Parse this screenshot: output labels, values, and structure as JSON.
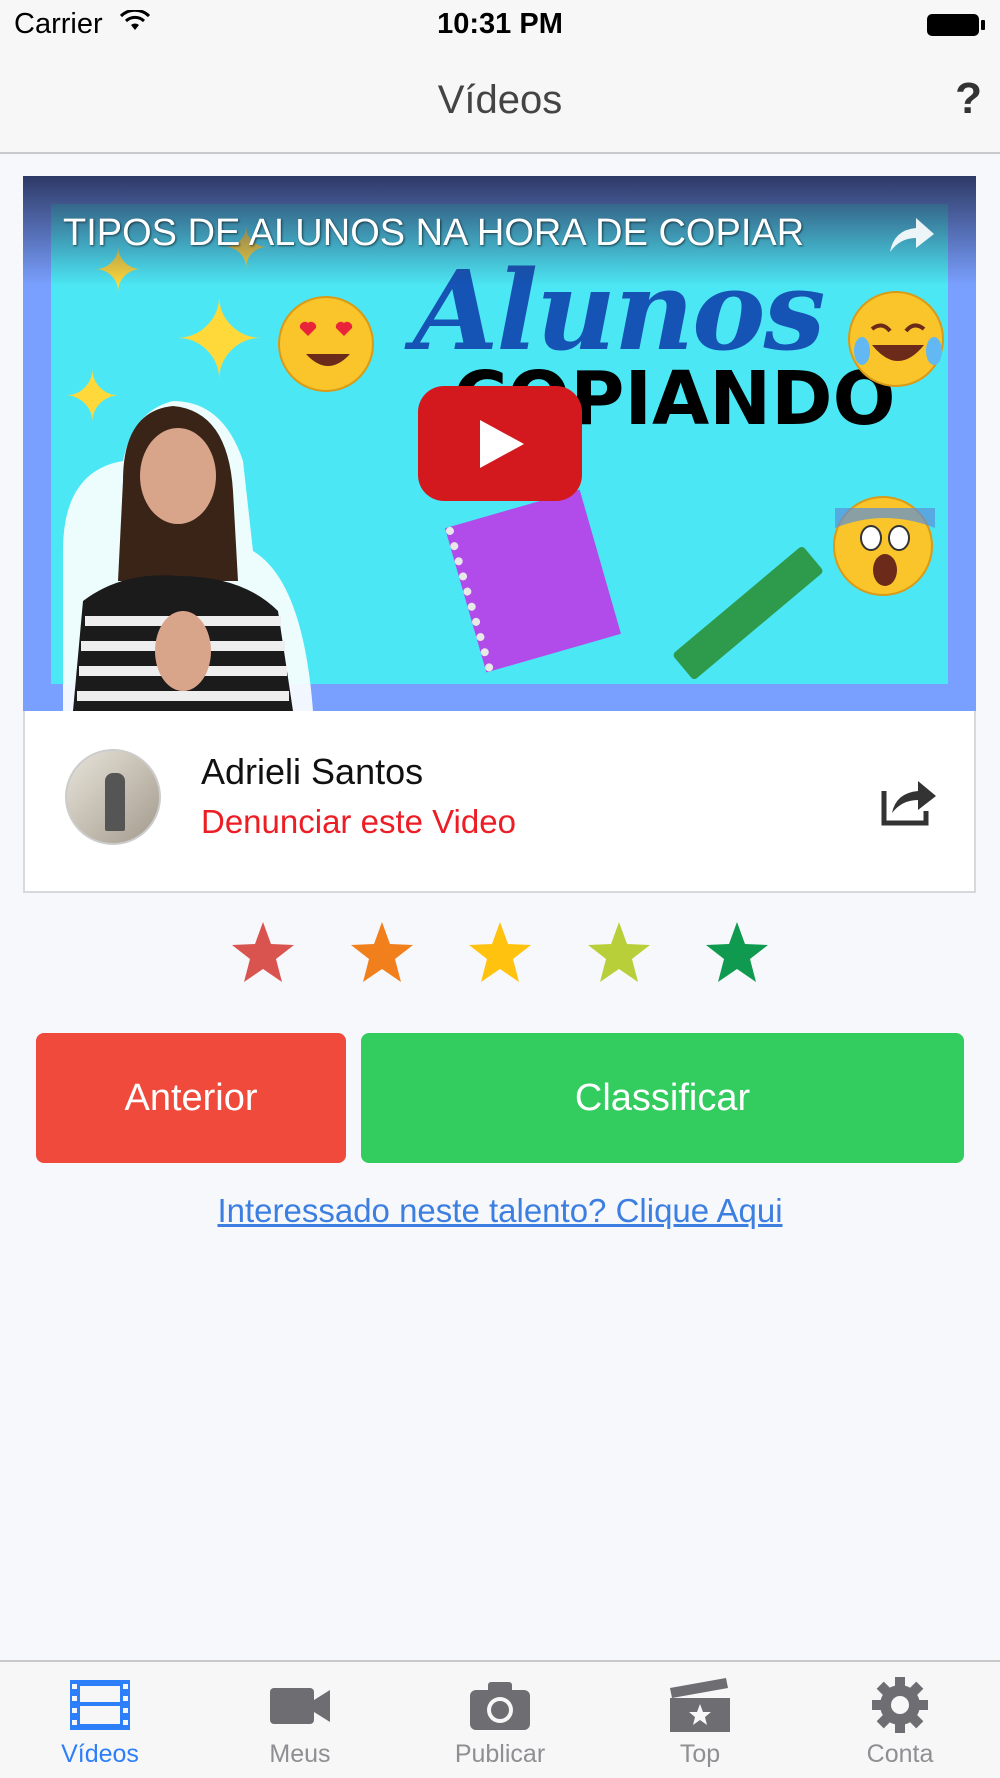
{
  "status_bar": {
    "carrier": "Carrier",
    "time": "10:31 PM",
    "icons": [
      "wifi-icon",
      "battery-icon"
    ]
  },
  "nav": {
    "title": "Vídeos",
    "help_label": "?"
  },
  "video": {
    "title": "TIPOS DE ALUNOS NA HORA DE COPIAR",
    "thumbnail_text_1": "Alunos",
    "thumbnail_text_2": "COPIANDO",
    "play_icon": "youtube-play-icon"
  },
  "author": {
    "name": "Adrieli Santos",
    "report_label": "Denunciar este Video",
    "share_icon": "share-icon"
  },
  "rating": {
    "star_colors": [
      "#d9534f",
      "#f07f1c",
      "#ffc20e",
      "#b9cf3a",
      "#0f9a4f"
    ]
  },
  "buttons": {
    "previous_label": "Anterior",
    "rate_label": "Classificar"
  },
  "talent_link": "Interessado neste talento? Clique Aqui",
  "tabs": [
    {
      "label": "Vídeos",
      "icon": "film-icon",
      "active": true
    },
    {
      "label": "Meus",
      "icon": "video-camera-icon",
      "active": false
    },
    {
      "label": "Publicar",
      "icon": "camera-icon",
      "active": false
    },
    {
      "label": "Top",
      "icon": "clapperboard-star-icon",
      "active": false
    },
    {
      "label": "Conta",
      "icon": "gear-icon",
      "active": false
    }
  ],
  "colors": {
    "accent_blue": "#2d7ff9",
    "report_red": "#ec1d24",
    "previous_red": "#ef4a3c",
    "rate_green": "#33cc5e",
    "link_blue": "#3d7fe0"
  }
}
